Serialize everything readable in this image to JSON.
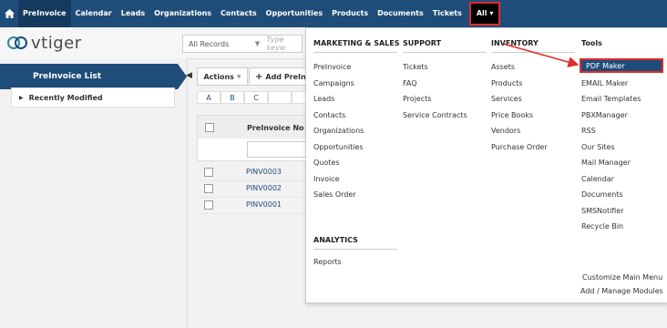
{
  "nav": {
    "items": [
      "PreInvoice",
      "Calendar",
      "Leads",
      "Organizations",
      "Contacts",
      "Opportunities",
      "Products",
      "Documents",
      "Tickets"
    ],
    "all_label": "All"
  },
  "logo": {
    "text": "vtiger"
  },
  "records": {
    "selected": "All Records",
    "placeholder": "Type keyw"
  },
  "sidebar": {
    "title": "PreInvoice List",
    "recently_modified": "Recently Modified"
  },
  "toolbar": {
    "actions_label": "Actions",
    "add_label": "Add PreInvo"
  },
  "alphabet": [
    "A",
    "B",
    "C"
  ],
  "list": {
    "column": "PreInvoice No",
    "rows": [
      "PINV0003",
      "PINV0002",
      "PINV0001"
    ]
  },
  "menu": {
    "marketing": {
      "header": "MARKETING & SALES",
      "items": [
        "PreInvoice",
        "Campaigns",
        "Leads",
        "Contacts",
        "Organizations",
        "Opportunities",
        "Quotes",
        "Invoice",
        "Sales Order"
      ]
    },
    "support": {
      "header": "SUPPORT",
      "items": [
        "Tickets",
        "FAQ",
        "Projects",
        "Service Contracts"
      ]
    },
    "inventory": {
      "header": "INVENTORY",
      "items": [
        "Assets",
        "Products",
        "Services",
        "Price Books",
        "Vendors",
        "Purchase Order"
      ]
    },
    "tools": {
      "header": "Tools",
      "items": [
        "PDF Maker",
        "EMAIL Maker",
        "Email Templates",
        "PBXManager",
        "RSS",
        "Our Sites",
        "Mail Manager",
        "Calendar",
        "Documents",
        "SMSNotifier",
        "Recycle Bin"
      ]
    },
    "analytics": {
      "header": "ANALYTICS",
      "items": [
        "Reports"
      ]
    },
    "footer": {
      "customize": "Customize Main Menu",
      "manage": "Add / Manage Modules"
    }
  },
  "colors": {
    "nav_bg": "#1f4d7a",
    "highlight": "#e02b2b"
  }
}
